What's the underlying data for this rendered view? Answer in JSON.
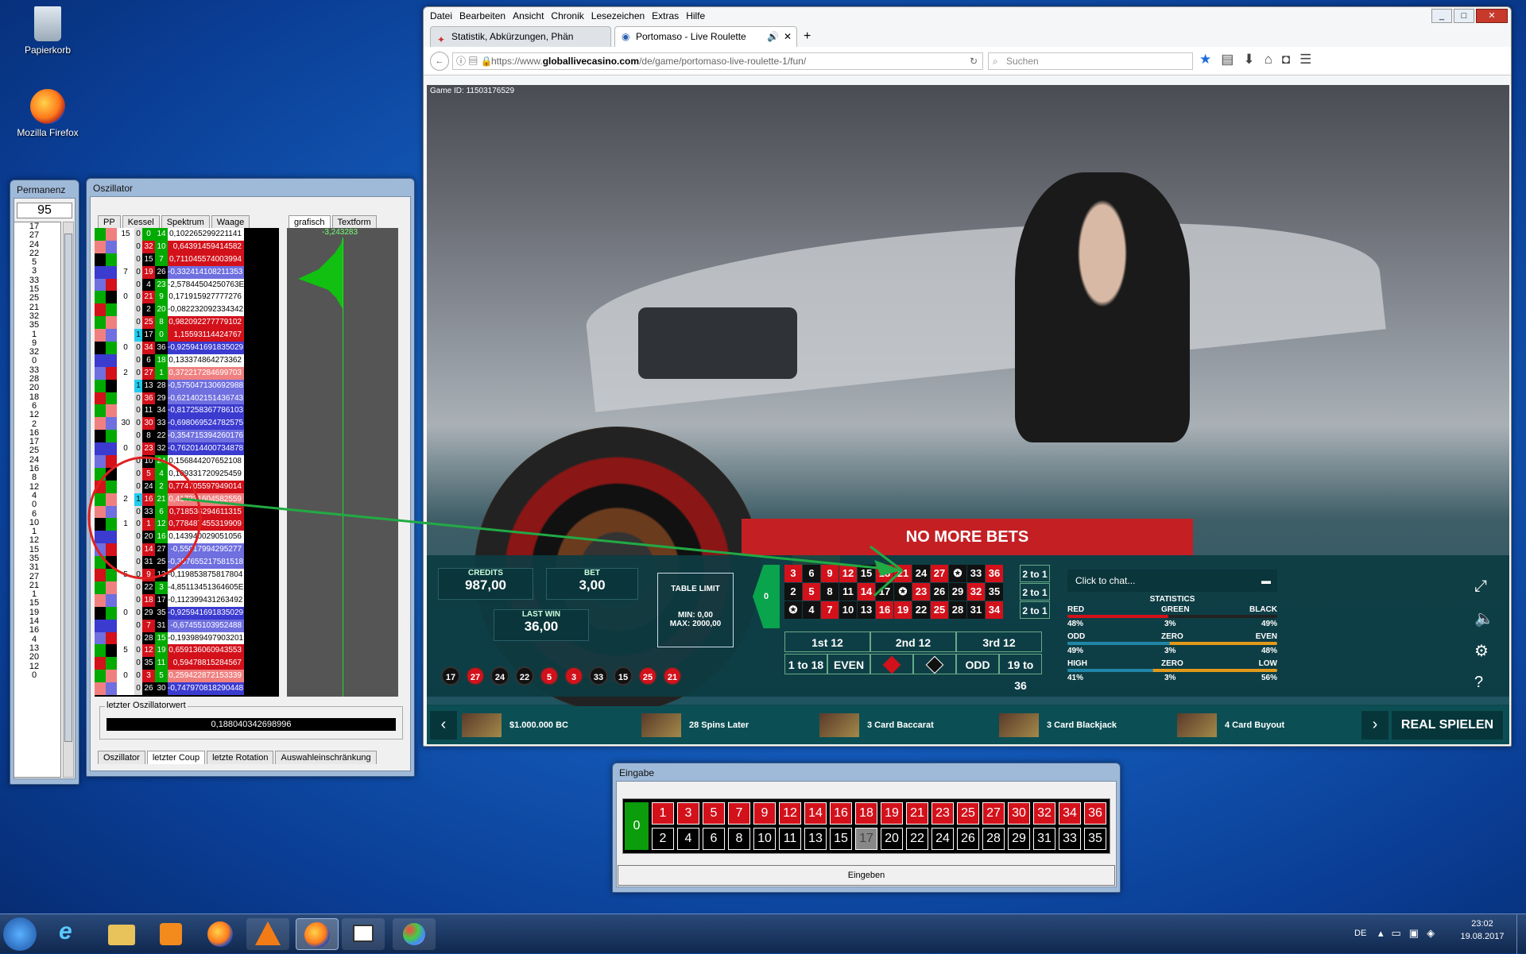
{
  "desktop": {
    "icons": [
      {
        "label": "Papierkorb"
      },
      {
        "label": "Mozilla Firefox"
      }
    ]
  },
  "permanenz": {
    "title": "Permanenz",
    "input": "95",
    "list": [
      "17",
      "27",
      "24",
      "22",
      "5",
      "3",
      "33",
      "15",
      "25",
      "21",
      "32",
      "35",
      "1",
      "9",
      "32",
      "0",
      "33",
      "28",
      "20",
      "18",
      "6",
      "12",
      "2",
      "16",
      "17",
      "25",
      "24",
      "16",
      "8",
      "12",
      "4",
      "0",
      "6",
      "10",
      "1",
      "12",
      "15",
      "35",
      "31",
      "27",
      "21",
      "1",
      "15",
      "19",
      "14",
      "16",
      "4",
      "13",
      "20",
      "12",
      "0"
    ]
  },
  "oszillator": {
    "title": "Oszillator",
    "tabs_top": [
      "PP",
      "Kessel",
      "Spektrum",
      "Waage",
      "grafisch",
      "Textform"
    ],
    "graph_top_label": "-3,243283",
    "group_labels": [
      "15",
      "7",
      "0",
      "0",
      "2",
      "30",
      "0",
      "2",
      "1",
      "5",
      "0",
      "5",
      "0"
    ],
    "rows": [
      {
        "a": "0",
        "b": "0",
        "c": "14",
        "v": "0,102265299221141",
        "bg": "#fff",
        "fg": "#000",
        "bc": "#0a0",
        "cc": "#0a0"
      },
      {
        "a": "0",
        "b": "32",
        "c": "10",
        "v": "0,64391459414582",
        "bg": "#d3111b",
        "fg": "#fff",
        "bc": "#d3111b",
        "cc": "#0a0"
      },
      {
        "a": "0",
        "b": "15",
        "c": "7",
        "v": "0,711045574003994",
        "bg": "#d3111b",
        "fg": "#fff",
        "bc": "#000",
        "cc": "#0a0"
      },
      {
        "a": "0",
        "b": "19",
        "c": "26",
        "v": "-0,332414108211353",
        "bg": "#6f6fe0",
        "fg": "#fff",
        "bc": "#d3111b",
        "cc": "#000"
      },
      {
        "a": "0",
        "b": "4",
        "c": "23",
        "v": "-2,57844504250763E-02",
        "bg": "#fff",
        "fg": "#000",
        "bc": "#000",
        "cc": "#0a0"
      },
      {
        "a": "0",
        "b": "21",
        "c": "9",
        "v": "0,171915927777276",
        "bg": "#fff",
        "fg": "#000",
        "bc": "#d3111b",
        "cc": "#0a0"
      },
      {
        "a": "0",
        "b": "2",
        "c": "20",
        "v": "-0,082232092334342",
        "bg": "#fff",
        "fg": "#000",
        "bc": "#000",
        "cc": "#0a0"
      },
      {
        "a": "0",
        "b": "25",
        "c": "8",
        "v": "0,982092277779102",
        "bg": "#d3111b",
        "fg": "#fff",
        "bc": "#d3111b",
        "cc": "#0a0"
      },
      {
        "a": "1",
        "b": "17",
        "c": "0",
        "v": "1,15593114424767",
        "bg": "#d3111b",
        "fg": "#fff",
        "bc": "#000",
        "cc": "#0a0"
      },
      {
        "a": "0",
        "b": "34",
        "c": "36",
        "v": "-0,925941691835029",
        "bg": "#3b3bd0",
        "fg": "#fff",
        "bc": "#d3111b",
        "cc": "#000"
      },
      {
        "a": "0",
        "b": "6",
        "c": "18",
        "v": "0,133374864273362",
        "bg": "#fff",
        "fg": "#000",
        "bc": "#000",
        "cc": "#0a0"
      },
      {
        "a": "0",
        "b": "27",
        "c": "1",
        "v": "0,372217284699703",
        "bg": "#f08080",
        "fg": "#fff",
        "bc": "#d3111b",
        "cc": "#0a0"
      },
      {
        "a": "1",
        "b": "13",
        "c": "28",
        "v": "-0,575047130692988",
        "bg": "#6f6fe0",
        "fg": "#fff",
        "bc": "#000",
        "cc": "#000"
      },
      {
        "a": "0",
        "b": "36",
        "c": "29",
        "v": "-0,621402151436743",
        "bg": "#6f6fe0",
        "fg": "#fff",
        "bc": "#d3111b",
        "cc": "#000"
      },
      {
        "a": "0",
        "b": "11",
        "c": "34",
        "v": "-0,817258367786103",
        "bg": "#3b3bd0",
        "fg": "#fff",
        "bc": "#000",
        "cc": "#000"
      },
      {
        "a": "0",
        "b": "30",
        "c": "33",
        "v": "-0,698069524782575",
        "bg": "#3b3bd0",
        "fg": "#fff",
        "bc": "#d3111b",
        "cc": "#000"
      },
      {
        "a": "0",
        "b": "8",
        "c": "22",
        "v": "-0,354715394260176",
        "bg": "#6f6fe0",
        "fg": "#fff",
        "bc": "#000",
        "cc": "#000"
      },
      {
        "a": "0",
        "b": "23",
        "c": "32",
        "v": "-0,762014400734878",
        "bg": "#3b3bd0",
        "fg": "#fff",
        "bc": "#d3111b",
        "cc": "#000"
      },
      {
        "a": "0",
        "b": "10",
        "c": "24",
        "v": "0,156844207652108",
        "bg": "#fff",
        "fg": "#000",
        "bc": "#000",
        "cc": "#0a0"
      },
      {
        "a": "0",
        "b": "5",
        "c": "4",
        "v": "0,109331720925459",
        "bg": "#fff",
        "fg": "#000",
        "bc": "#d3111b",
        "cc": "#0a0"
      },
      {
        "a": "0",
        "b": "24",
        "c": "2",
        "v": "0,774705597949014",
        "bg": "#d3111b",
        "fg": "#fff",
        "bc": "#000",
        "cc": "#0a0"
      },
      {
        "a": "1",
        "b": "16",
        "c": "21",
        "v": "0,417231604582559",
        "bg": "#f08080",
        "fg": "#fff",
        "bc": "#d3111b",
        "cc": "#0a0"
      },
      {
        "a": "0",
        "b": "33",
        "c": "6",
        "v": "0,718536294611315",
        "bg": "#d3111b",
        "fg": "#fff",
        "bc": "#000",
        "cc": "#0a0"
      },
      {
        "a": "0",
        "b": "1",
        "c": "12",
        "v": "0,778487455319909",
        "bg": "#d3111b",
        "fg": "#fff",
        "bc": "#d3111b",
        "cc": "#0a0"
      },
      {
        "a": "0",
        "b": "20",
        "c": "16",
        "v": "0,143940029051056",
        "bg": "#fff",
        "fg": "#000",
        "bc": "#000",
        "cc": "#0a0"
      },
      {
        "a": "0",
        "b": "14",
        "c": "27",
        "v": "-0,55017994295277",
        "bg": "#6f6fe0",
        "fg": "#fff",
        "bc": "#d3111b",
        "cc": "#000"
      },
      {
        "a": "0",
        "b": "31",
        "c": "25",
        "v": "-0,357655217581518",
        "bg": "#6f6fe0",
        "fg": "#fff",
        "bc": "#000",
        "cc": "#000"
      },
      {
        "a": "0",
        "b": "9",
        "c": "13",
        "v": "-0,119853875817804",
        "bg": "#fff",
        "fg": "#000",
        "bc": "#d3111b",
        "cc": "#000"
      },
      {
        "a": "0",
        "b": "22",
        "c": "3",
        "v": "-4,85113451364605E-03",
        "bg": "#fff",
        "fg": "#000",
        "bc": "#000",
        "cc": "#0a0"
      },
      {
        "a": "0",
        "b": "18",
        "c": "17",
        "v": "-0,112399431263492",
        "bg": "#fff",
        "fg": "#000",
        "bc": "#d3111b",
        "cc": "#000"
      },
      {
        "a": "0",
        "b": "29",
        "c": "35",
        "v": "-0,925941691835029",
        "bg": "#3b3bd0",
        "fg": "#fff",
        "bc": "#000",
        "cc": "#000"
      },
      {
        "a": "0",
        "b": "7",
        "c": "31",
        "v": "-0,67455103952488",
        "bg": "#6f6fe0",
        "fg": "#fff",
        "bc": "#d3111b",
        "cc": "#000"
      },
      {
        "a": "0",
        "b": "28",
        "c": "15",
        "v": "-0,193989497903201",
        "bg": "#fff",
        "fg": "#000",
        "bc": "#000",
        "cc": "#0a0"
      },
      {
        "a": "0",
        "b": "12",
        "c": "19",
        "v": "0,659136060943553",
        "bg": "#d3111b",
        "fg": "#fff",
        "bc": "#d3111b",
        "cc": "#0a0"
      },
      {
        "a": "0",
        "b": "35",
        "c": "11",
        "v": "0,59478815284567",
        "bg": "#d3111b",
        "fg": "#fff",
        "bc": "#000",
        "cc": "#0a0"
      },
      {
        "a": "0",
        "b": "3",
        "c": "5",
        "v": "0,259422872153339",
        "bg": "#f08080",
        "fg": "#fff",
        "bc": "#d3111b",
        "cc": "#0a0"
      },
      {
        "a": "0",
        "b": "26",
        "c": "30",
        "v": "-0,747970818290448",
        "bg": "#3b3bd0",
        "fg": "#fff",
        "bc": "#000",
        "cc": "#000"
      }
    ],
    "letzter_label": "letzter Oszillatorwert",
    "letzter_value": "0,188040342698996",
    "tabs_bottom": [
      "Oszillator",
      "letzter Coup",
      "letzte Rotation",
      "Auswahleinschränkung"
    ]
  },
  "firefox": {
    "menu": [
      "Datei",
      "Bearbeiten",
      "Ansicht",
      "Chronik",
      "Lesezeichen",
      "Extras",
      "Hilfe"
    ],
    "tabs": [
      {
        "label": "Statistik, Abkürzungen, Phän"
      },
      {
        "label": "Portomaso - Live Roulette"
      }
    ],
    "url_prefix": "https://www.",
    "url_domain": "globallivecasino.com",
    "url_path": "/de/game/portomaso-live-roulette-1/fun/",
    "search_placeholder": "Suchen"
  },
  "game": {
    "game_id": "Game ID: 11503176529",
    "banner": "NO MORE BETS",
    "credits_label": "CREDITS",
    "credits": "987,00",
    "bet_label": "BET",
    "bet": "3,00",
    "last_win_label": "LAST WIN",
    "last_win": "36,00",
    "table_limit": "TABLE LIMIT",
    "min": "MIN: 0,00",
    "max": "MAX: 2000,00",
    "chat_placeholder": "Click to chat...",
    "history": [
      {
        "n": "17",
        "c": "#111"
      },
      {
        "n": "27",
        "c": "#d3111b"
      },
      {
        "n": "24",
        "c": "#111"
      },
      {
        "n": "22",
        "c": "#111"
      },
      {
        "n": "5",
        "c": "#d3111b"
      },
      {
        "n": "3",
        "c": "#d3111b"
      },
      {
        "n": "33",
        "c": "#111"
      },
      {
        "n": "15",
        "c": "#111"
      },
      {
        "n": "25",
        "c": "#d3111b"
      },
      {
        "n": "21",
        "c": "#d3111b"
      }
    ],
    "board_rows": [
      [
        "3",
        "6",
        "9",
        "12",
        "15",
        "18",
        "21",
        "24",
        "27",
        "30",
        "33",
        "36"
      ],
      [
        "2",
        "5",
        "8",
        "11",
        "14",
        "17",
        "20",
        "23",
        "26",
        "29",
        "32",
        "35"
      ],
      [
        "1",
        "4",
        "7",
        "10",
        "13",
        "16",
        "19",
        "22",
        "25",
        "28",
        "31",
        "34"
      ]
    ],
    "board_icons": "✪",
    "two_to_one": "2 to 1",
    "dozens": [
      "1st 12",
      "2nd 12",
      "3rd 12"
    ],
    "outside": [
      "1 to 18",
      "EVEN",
      "",
      "",
      "ODD",
      "19 to 36"
    ],
    "zero": "0",
    "stats": {
      "title": "STATISTICS",
      "rows": [
        {
          "l": "RED",
          "m": "GREEN",
          "r": "BLACK",
          "lv": "48%",
          "mv": "3%",
          "rv": "49%"
        },
        {
          "l": "ODD",
          "m": "ZERO",
          "r": "EVEN",
          "lv": "49%",
          "mv": "3%",
          "rv": "48%"
        },
        {
          "l": "HIGH",
          "m": "ZERO",
          "r": "LOW",
          "lv": "41%",
          "mv": "3%",
          "rv": "56%"
        }
      ]
    },
    "bottom_games": [
      {
        "label": "$1.000.000 BC"
      },
      {
        "label": "28 Spins Later"
      },
      {
        "label": "3 Card Baccarat"
      },
      {
        "label": "3 Card Blackjack"
      },
      {
        "label": "4 Card Buyout"
      }
    ],
    "real_spielen": "REAL SPIELEN"
  },
  "eingabe": {
    "title": "Eingabe",
    "zero": "0",
    "top": [
      "1",
      "3",
      "5",
      "7",
      "9",
      "12",
      "14",
      "16",
      "18",
      "19",
      "21",
      "23",
      "25",
      "27",
      "30",
      "32",
      "34",
      "36"
    ],
    "bottom": [
      "2",
      "4",
      "6",
      "8",
      "10",
      "11",
      "13",
      "15",
      "17",
      "20",
      "22",
      "24",
      "26",
      "28",
      "29",
      "31",
      "33",
      "35"
    ],
    "highlight": "17",
    "button": "Eingeben"
  },
  "taskbar": {
    "lang": "DE",
    "time": "23:02",
    "date": "19.08.2017"
  },
  "colors": {
    "red": "#d3111b",
    "green": "#00a000",
    "teal": "#0b4f54"
  }
}
